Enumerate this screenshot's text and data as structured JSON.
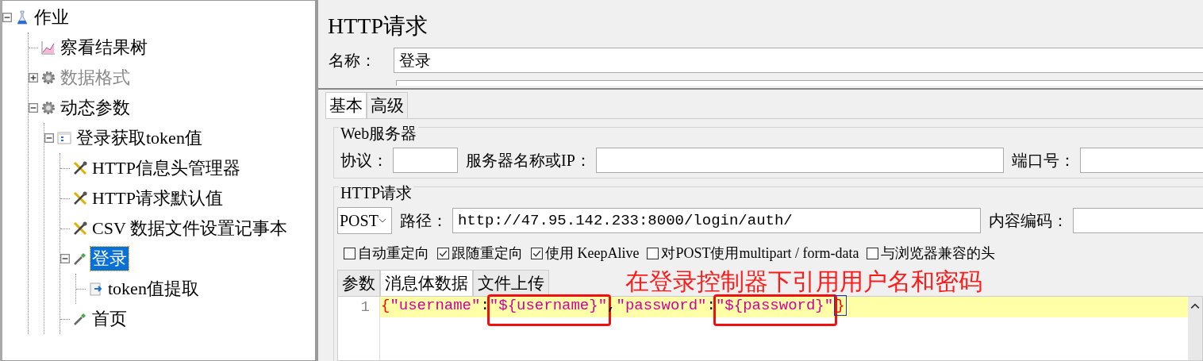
{
  "tree": [
    {
      "label": "作业",
      "kind": "flask",
      "expanded": true,
      "selected": false,
      "disabled": false,
      "children": [
        {
          "label": "察看结果树",
          "kind": "chart",
          "selected": false,
          "disabled": false
        },
        {
          "label": "数据格式",
          "kind": "gear",
          "expanded": false,
          "selected": false,
          "disabled": true
        },
        {
          "label": "动态参数",
          "kind": "gear",
          "expanded": true,
          "selected": false,
          "disabled": false,
          "children": [
            {
              "label": "登录获取token值",
              "kind": "controller",
              "expanded": true,
              "selected": false,
              "disabled": false,
              "children": [
                {
                  "label": "HTTP信息头管理器",
                  "kind": "tools",
                  "selected": false,
                  "disabled": false
                },
                {
                  "label": "HTTP请求默认值",
                  "kind": "tools",
                  "selected": false,
                  "disabled": false
                },
                {
                  "label": "CSV 数据文件设置记事本",
                  "kind": "tools",
                  "selected": false,
                  "disabled": false
                },
                {
                  "label": "登录",
                  "kind": "dropper",
                  "expanded": true,
                  "selected": true,
                  "disabled": false,
                  "children": [
                    {
                      "label": "token值提取",
                      "kind": "extractor",
                      "selected": false,
                      "disabled": false
                    }
                  ]
                },
                {
                  "label": "首页",
                  "kind": "dropper",
                  "selected": false,
                  "disabled": false
                }
              ]
            }
          ]
        }
      ]
    }
  ],
  "editor": {
    "title": "HTTP请求",
    "name_label": "名称：",
    "name_value": "登录",
    "tabs": [
      {
        "label": "基本",
        "selected": true
      },
      {
        "label": "高级",
        "selected": false
      }
    ],
    "web_server": {
      "legend": "Web服务器",
      "protocol_label": "协议：",
      "server_label": "服务器名称或IP：",
      "port_label": "端口号："
    },
    "http_request": {
      "legend": "HTTP请求",
      "method": "POST",
      "path_label": "路径：",
      "path_value": "http://47.95.142.233:8000/login/auth/",
      "encoding_label": "内容编码：",
      "options": [
        {
          "label": "自动重定向",
          "checked": false
        },
        {
          "label": "跟随重定向",
          "checked": true
        },
        {
          "label": "使用 KeepAlive",
          "checked": true
        },
        {
          "label": "对POST使用multipart / form-data",
          "checked": false
        },
        {
          "label": "与浏览器兼容的头",
          "checked": false
        }
      ],
      "body_tabs": [
        {
          "label": "参数",
          "selected": false
        },
        {
          "label": "消息体数据",
          "selected": true
        },
        {
          "label": "文件上传",
          "selected": false
        }
      ],
      "annotation": "在登录控制器下引用用户名和密码",
      "code_lines": [
        {
          "number": "1",
          "tokens": [
            {
              "text": "{",
              "kind": "brace",
              "highlighted": false
            },
            {
              "text": "\"username\"",
              "kind": "string",
              "highlighted": false
            },
            {
              "text": ":",
              "kind": "punct",
              "highlighted": false
            },
            {
              "text": "\"${username}\"",
              "kind": "string",
              "highlighted": true
            },
            {
              "text": ",",
              "kind": "punct",
              "highlighted": false
            },
            {
              "text": "\"password\"",
              "kind": "string",
              "highlighted": false
            },
            {
              "text": ":",
              "kind": "punct",
              "highlighted": false
            },
            {
              "text": "\"${password}\"",
              "kind": "string",
              "highlighted": true
            },
            {
              "text": "}",
              "kind": "matched-brace",
              "highlighted": false
            }
          ]
        }
      ]
    }
  }
}
